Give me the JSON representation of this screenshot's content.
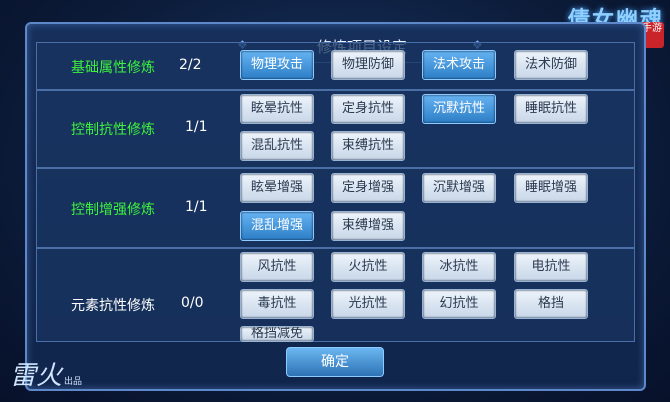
{
  "dialog": {
    "title": "修炼项目设定",
    "close_label": "✕",
    "confirm_label": "确定"
  },
  "logo": {
    "text": "倩女幽魂",
    "badge": "手游"
  },
  "brand": {
    "text": "雷火",
    "sub": "出品"
  },
  "rows": [
    {
      "label": "基础属性修炼",
      "count": "2/2",
      "options": [
        {
          "label": "物理攻击",
          "selected": true
        },
        {
          "label": "物理防御",
          "selected": false
        },
        {
          "label": "法术攻击",
          "selected": true
        },
        {
          "label": "法术防御",
          "selected": false
        }
      ]
    },
    {
      "label": "控制抗性修炼",
      "count": "1/1",
      "options": [
        {
          "label": "眩晕抗性",
          "selected": false
        },
        {
          "label": "定身抗性",
          "selected": false
        },
        {
          "label": "沉默抗性",
          "selected": true
        },
        {
          "label": "睡眠抗性",
          "selected": false
        },
        {
          "label": "混乱抗性",
          "selected": false
        },
        {
          "label": "束缚抗性",
          "selected": false
        }
      ]
    },
    {
      "label": "控制增强修炼",
      "count": "1/1",
      "options": [
        {
          "label": "眩晕增强",
          "selected": false
        },
        {
          "label": "定身增强",
          "selected": false
        },
        {
          "label": "沉默增强",
          "selected": false
        },
        {
          "label": "睡眠增强",
          "selected": false
        },
        {
          "label": "混乱增强",
          "selected": true
        },
        {
          "label": "束缚增强",
          "selected": false
        }
      ]
    },
    {
      "label": "元素抗性修炼",
      "count": "0/0",
      "options": [
        {
          "label": "风抗性",
          "selected": false
        },
        {
          "label": "火抗性",
          "selected": false
        },
        {
          "label": "冰抗性",
          "selected": false
        },
        {
          "label": "电抗性",
          "selected": false
        },
        {
          "label": "毒抗性",
          "selected": false
        },
        {
          "label": "光抗性",
          "selected": false
        },
        {
          "label": "幻抗性",
          "selected": false
        },
        {
          "label": "格挡",
          "selected": false
        },
        {
          "label": "格挡减免",
          "selected": false
        }
      ]
    }
  ],
  "colors": {
    "label_green": "#3df23d",
    "selected_blue": "#2d7ec6",
    "unselected": "#d8e4f2"
  }
}
